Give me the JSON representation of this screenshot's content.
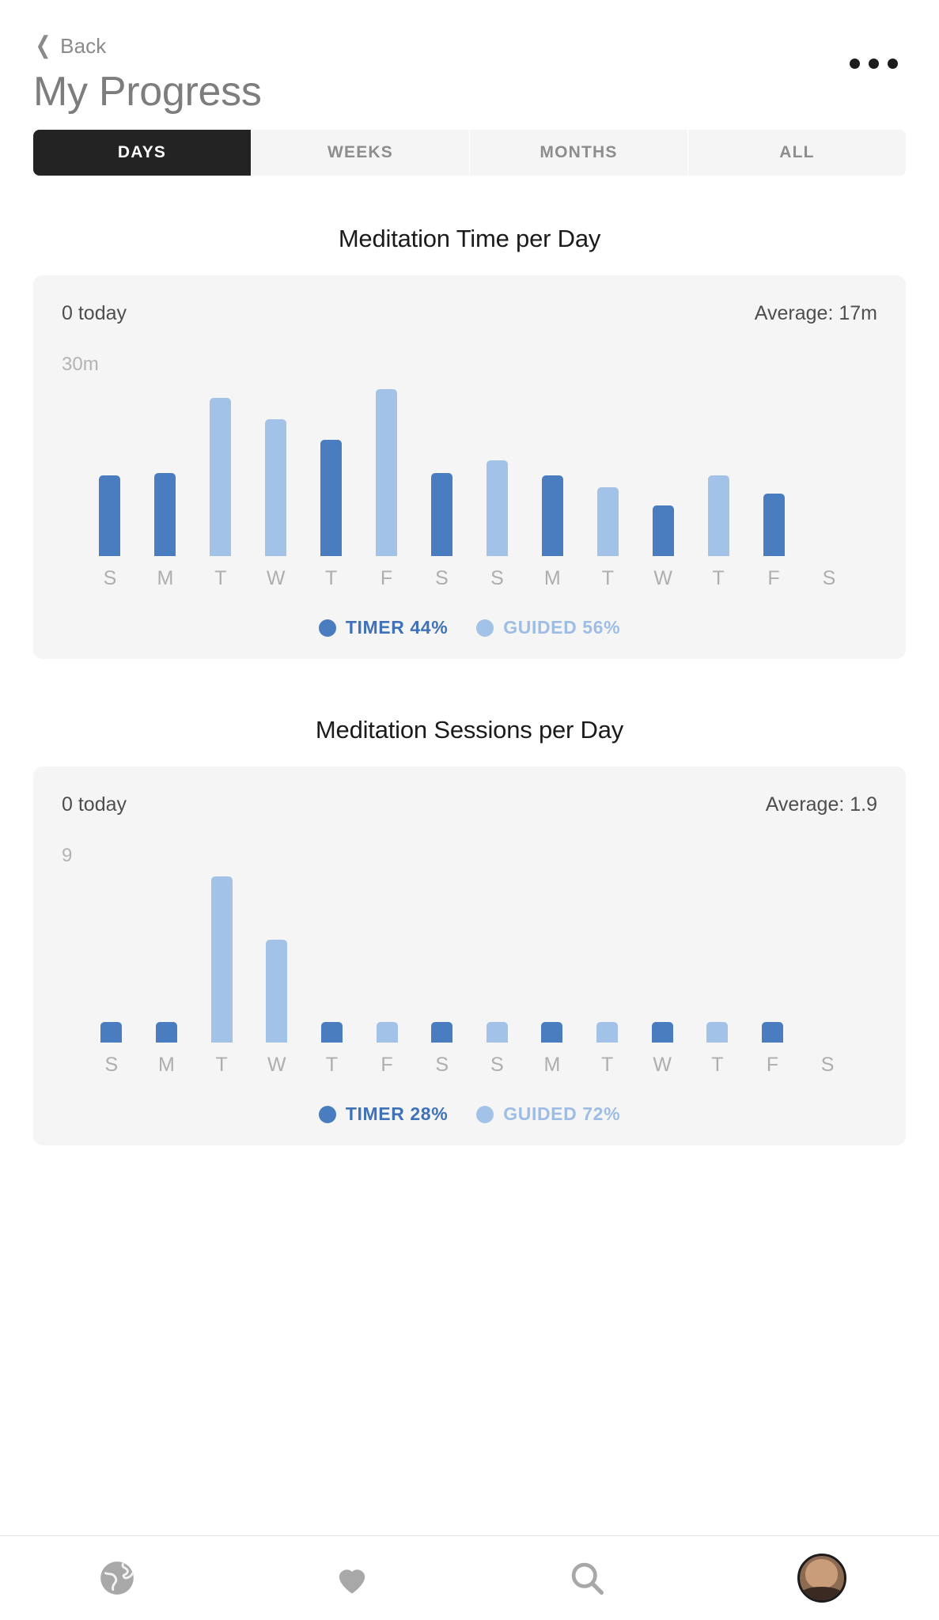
{
  "header": {
    "back_label": "Back",
    "back_icon": "chevron-left-icon",
    "title": "My Progress",
    "more_icon": "more-horizontal-icon"
  },
  "tabs": [
    {
      "label": "DAYS",
      "active": true
    },
    {
      "label": "WEEKS",
      "active": false
    },
    {
      "label": "MONTHS",
      "active": false
    },
    {
      "label": "ALL",
      "active": false
    }
  ],
  "colors": {
    "timer": "#4a7cc0",
    "guided": "#a3c2e8",
    "card_bg": "#f5f5f5",
    "active_tab_bg": "#232323",
    "muted_text": "#aeaeae"
  },
  "sections": [
    {
      "title": "Meditation Time per Day",
      "today_label": "0 today",
      "average_label": "Average:  17m",
      "axis_max_label": "30m",
      "legend": [
        {
          "label": "TIMER 44%",
          "series": "timer"
        },
        {
          "label": "GUIDED 56%",
          "series": "guided"
        }
      ]
    },
    {
      "title": "Meditation Sessions per Day",
      "today_label": "0 today",
      "average_label": "Average: 1.9",
      "axis_max_label": "9",
      "legend": [
        {
          "label": "TIMER 28%",
          "series": "timer"
        },
        {
          "label": "GUIDED 72%",
          "series": "guided"
        }
      ]
    }
  ],
  "bottom_nav": [
    {
      "icon": "globe-icon",
      "label": ""
    },
    {
      "icon": "heart-icon",
      "label": ""
    },
    {
      "icon": "search-icon",
      "label": ""
    },
    {
      "icon": "avatar-icon",
      "label": ""
    }
  ],
  "chart_data": [
    {
      "type": "bar",
      "title": "Meditation Time per Day",
      "xlabel": "",
      "ylabel": "minutes",
      "ylim": [
        0,
        30
      ],
      "grid": false,
      "legend_position": "bottom",
      "categories": [
        "S",
        "M",
        "T",
        "W",
        "T",
        "F",
        "S",
        "S",
        "M",
        "T",
        "W",
        "T",
        "F",
        "S"
      ],
      "values": [
        13.5,
        14.0,
        26.5,
        23.0,
        19.5,
        28.0,
        14.0,
        16.0,
        13.5,
        11.5,
        8.5,
        13.5,
        10.5,
        0
      ],
      "bar_series": [
        "timer",
        "timer",
        "guided",
        "guided",
        "timer",
        "guided",
        "timer",
        "guided",
        "timer",
        "guided",
        "timer",
        "guided",
        "timer",
        "guided"
      ],
      "series": [
        {
          "name": "TIMER",
          "color": "#4a7cc0",
          "share_pct": 44
        },
        {
          "name": "GUIDED",
          "color": "#a3c2e8",
          "share_pct": 56
        }
      ],
      "annotations": {
        "today": "0 today",
        "average": "Average:  17m",
        "axis_max": "30m"
      }
    },
    {
      "type": "bar",
      "title": "Meditation Sessions per Day",
      "xlabel": "",
      "ylabel": "sessions",
      "ylim": [
        0,
        9
      ],
      "grid": false,
      "legend_position": "bottom",
      "categories": [
        "S",
        "M",
        "T",
        "W",
        "T",
        "F",
        "S",
        "S",
        "M",
        "T",
        "W",
        "T",
        "F",
        "S"
      ],
      "values": [
        0.6,
        0.6,
        8.6,
        5.3,
        0.6,
        0.6,
        0.6,
        0.6,
        0.6,
        0.6,
        0.6,
        0.6,
        0.6,
        0
      ],
      "bar_series": [
        "timer",
        "timer",
        "guided",
        "guided",
        "timer",
        "guided",
        "timer",
        "guided",
        "timer",
        "guided",
        "timer",
        "guided",
        "timer",
        "guided"
      ],
      "series": [
        {
          "name": "TIMER",
          "color": "#4a7cc0",
          "share_pct": 28
        },
        {
          "name": "GUIDED",
          "color": "#a3c2e8",
          "share_pct": 72
        }
      ],
      "annotations": {
        "today": "0 today",
        "average": "Average: 1.9",
        "axis_max": "9"
      }
    }
  ]
}
